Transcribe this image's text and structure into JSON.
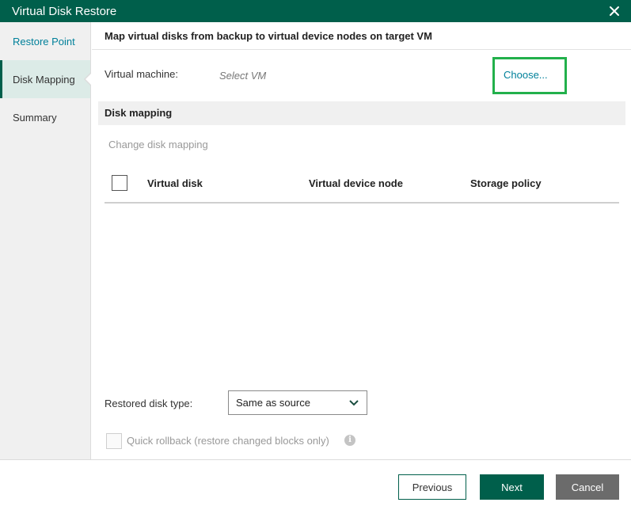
{
  "window": {
    "title": "Virtual Disk Restore"
  },
  "colors": {
    "brand": "#005f4b",
    "link": "#00809a",
    "highlight": "#22b04b"
  },
  "icons": {
    "close": "close-icon",
    "dropdown": "chevron-down-icon",
    "info": "info-icon"
  },
  "sidebar": {
    "items": [
      {
        "label": "Restore Point"
      },
      {
        "label": "Disk Mapping"
      },
      {
        "label": "Summary"
      }
    ]
  },
  "main": {
    "header": "Map virtual disks from backup to virtual device nodes on target VM",
    "vm_label": "Virtual machine:",
    "vm_value": "Select VM",
    "choose_label": "Choose...",
    "section_title": "Disk mapping",
    "change_link": "Change disk mapping",
    "table": {
      "columns": [
        "Virtual disk",
        "Virtual device node",
        "Storage policy"
      ],
      "rows": []
    },
    "disk_type_label": "Restored disk type:",
    "disk_type_value": "Same as source",
    "rollback_label": "Quick rollback (restore changed blocks only)",
    "info_glyph": "i"
  },
  "footer": {
    "previous": "Previous",
    "next": "Next",
    "cancel": "Cancel"
  }
}
